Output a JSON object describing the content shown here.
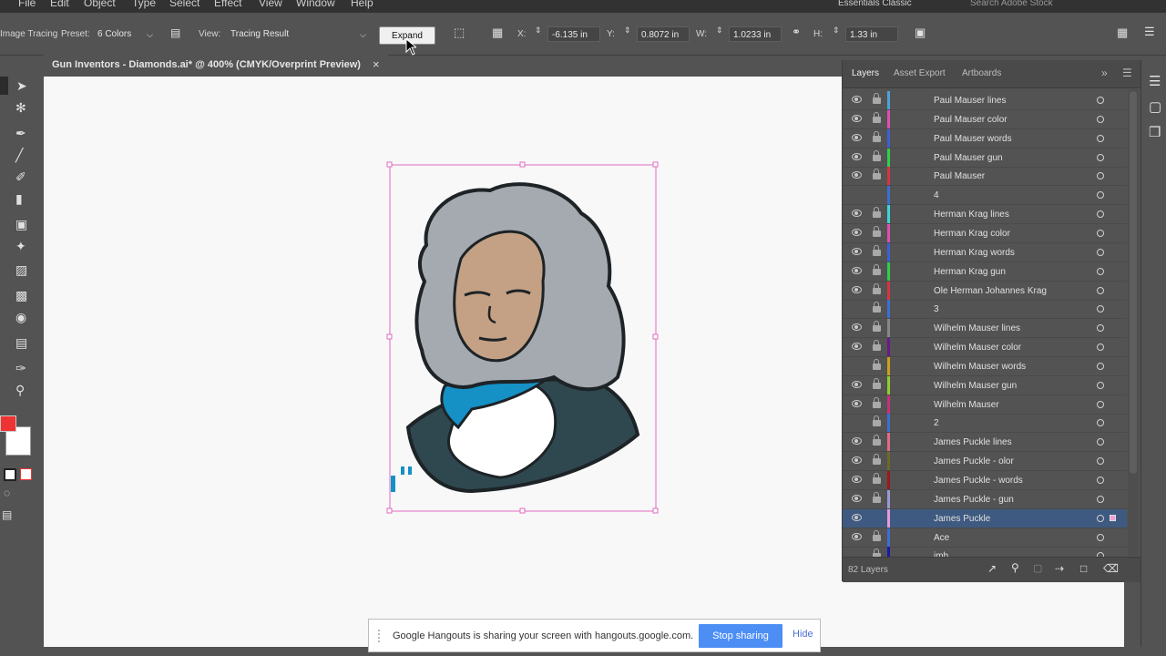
{
  "menubar": {
    "items": [
      "File",
      "Edit",
      "Object",
      "Type",
      "Select",
      "Effect",
      "View",
      "Window",
      "Help"
    ],
    "search_placeholder": "Search Adobe Stock",
    "workspace": "Essentials Classic"
  },
  "controlbar": {
    "panel_label": "Image Tracing",
    "preset_label": "Preset:",
    "preset_value": "6 Colors",
    "view_label": "View:",
    "view_value": "Tracing Result",
    "expand_label": "Expand",
    "x_label": "X:",
    "x_value": "-6.135 in",
    "y_label": "Y:",
    "y_value": "0.8072 in",
    "w_label": "W:",
    "w_value": "1.0233 in",
    "h_label": "H:",
    "h_value": "1.33 in"
  },
  "document": {
    "tab_title": "Gun Inventors - Diamonds.ai* @ 400% (CMYK/Overprint Preview)",
    "close_glyph": "×"
  },
  "panel": {
    "tabs": [
      {
        "label": "Layers"
      },
      {
        "label": "Asset Export"
      },
      {
        "label": "Artboards"
      }
    ],
    "layer_count": "82 Layers",
    "layers": [
      {
        "name": "Paul Mauser lines",
        "color": "#4aa3d9",
        "visible": true,
        "locked": true
      },
      {
        "name": "Paul Mauser color",
        "color": "#e04fb0",
        "visible": true,
        "locked": true
      },
      {
        "name": "Paul Mauser words",
        "color": "#3c5fd8",
        "visible": true,
        "locked": true
      },
      {
        "name": "Paul Mauser gun",
        "color": "#2fcf4a",
        "visible": true,
        "locked": true
      },
      {
        "name": "Paul Mauser",
        "color": "#d9333f",
        "visible": true,
        "locked": true
      },
      {
        "name": "4",
        "color": "#3b6fd6",
        "visible": false,
        "locked": false
      },
      {
        "name": "Herman Krag lines",
        "color": "#3ad6d6",
        "visible": true,
        "locked": true
      },
      {
        "name": "Herman Krag color",
        "color": "#e04fb0",
        "visible": true,
        "locked": true
      },
      {
        "name": "Herman Krag words",
        "color": "#3c5fd8",
        "visible": true,
        "locked": true
      },
      {
        "name": "Herman Krag gun",
        "color": "#2fcf4a",
        "visible": true,
        "locked": true
      },
      {
        "name": "Ole Herman Johannes Krag",
        "color": "#d9333f",
        "visible": true,
        "locked": true
      },
      {
        "name": "3",
        "color": "#3b6fd6",
        "visible": false,
        "locked": true
      },
      {
        "name": "Wilhelm Mauser lines",
        "color": "#888888",
        "visible": true,
        "locked": true
      },
      {
        "name": "Wilhelm Mauser color",
        "color": "#6a1a8a",
        "visible": true,
        "locked": true
      },
      {
        "name": "Wilhelm Mauser words",
        "color": "#c9a21a",
        "visible": false,
        "locked": true
      },
      {
        "name": "Wilhelm Mauser gun",
        "color": "#8fcf2a",
        "visible": true,
        "locked": true
      },
      {
        "name": "Wilhelm Mauser",
        "color": "#c8307a",
        "visible": true,
        "locked": true
      },
      {
        "name": "2",
        "color": "#3b6fd6",
        "visible": false,
        "locked": true
      },
      {
        "name": "James Puckle lines",
        "color": "#e26a8a",
        "visible": true,
        "locked": true
      },
      {
        "name": "James Puckle - olor",
        "color": "#6b6a2a",
        "visible": true,
        "locked": true
      },
      {
        "name": "James Puckle - words",
        "color": "#a01818",
        "visible": true,
        "locked": true
      },
      {
        "name": "James Puckle - gun",
        "color": "#9a9ad8",
        "visible": true,
        "locked": true
      },
      {
        "name": "James Puckle",
        "color": "#e89ad8",
        "visible": true,
        "locked": false,
        "selected": true
      },
      {
        "name": "Ace",
        "color": "#3b6fd6",
        "visible": true,
        "locked": true
      },
      {
        "name": "jmb",
        "color": "#1a1aa8",
        "visible": false,
        "locked": true
      }
    ]
  },
  "hangouts": {
    "message": "Google Hangouts is sharing your screen with hangouts.google.com.",
    "stop_label": "Stop sharing",
    "hide_label": "Hide"
  },
  "colors": {
    "selection": "#e26ac0",
    "accent_blue": "#4d8ef5"
  }
}
